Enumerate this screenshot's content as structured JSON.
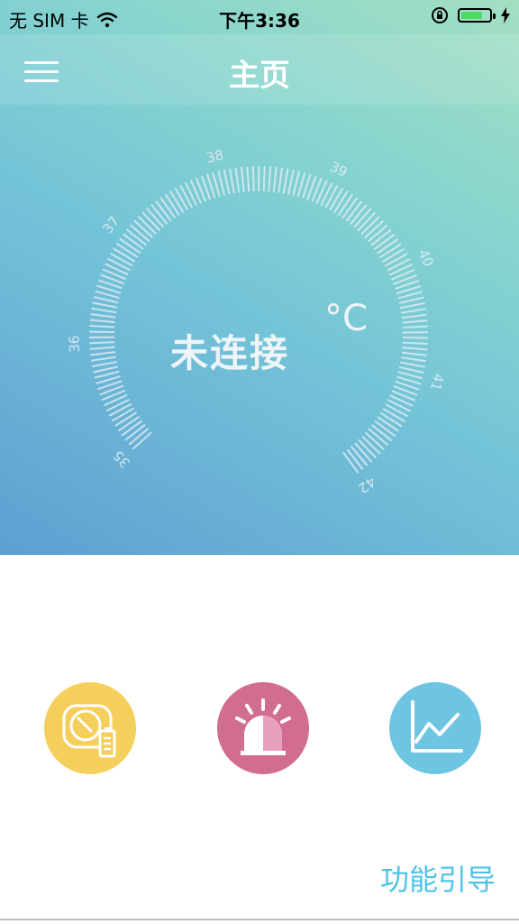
{
  "status_bar": {
    "carrier": "无 SIM 卡",
    "time": "下午3:36",
    "battery_level": 0.75,
    "icons": [
      "wifi-icon",
      "orientation-lock-icon",
      "battery-icon",
      "charging-icon"
    ]
  },
  "nav": {
    "title": "主页",
    "menu_icon": "hamburger-menu-icon"
  },
  "gauge": {
    "status": "未连接",
    "unit": "°C",
    "scale_min": 35,
    "scale_max": 42,
    "labels": [
      "35",
      "36",
      "37",
      "38",
      "39",
      "40",
      "41",
      "42"
    ]
  },
  "actions": [
    {
      "icon": "device-battery-icon",
      "color": "#f4cf5b"
    },
    {
      "icon": "alarm-light-icon",
      "color": "#d26d92"
    },
    {
      "icon": "line-chart-icon",
      "color": "#6ec5e2"
    }
  ],
  "footer": {
    "guide_label": "功能引导"
  },
  "colors": {
    "accent": "#4fc3e6",
    "hero_start": "#5e9fd2",
    "hero_end": "#a3dfc2"
  }
}
